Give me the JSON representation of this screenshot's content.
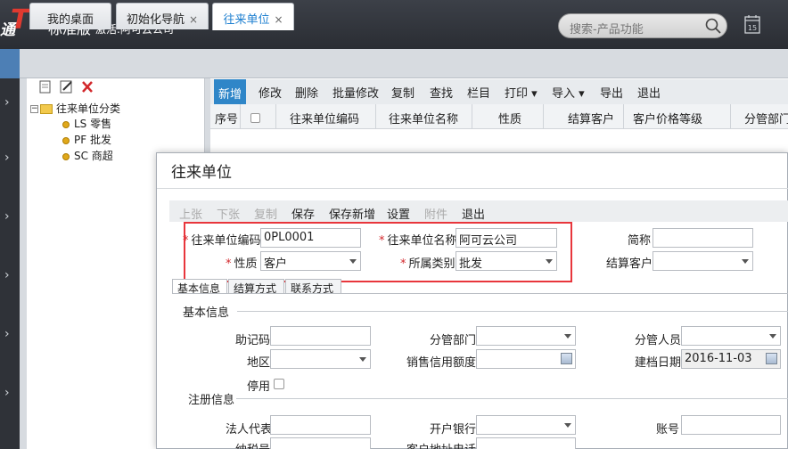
{
  "header": {
    "brand_edge": "通",
    "brand_logo": "T⁺",
    "edition": "标准版",
    "activate": "激活.阿可云公司",
    "search_placeholder": "搜索-产品功能",
    "calendar_day": "15"
  },
  "tabs": [
    {
      "label": "我的桌面"
    },
    {
      "label": "初始化导航",
      "close": "×"
    },
    {
      "label": "往来单位",
      "close": "×"
    }
  ],
  "tree": {
    "root": "往来单位分类",
    "items": [
      "LS 零售",
      "PF 批发",
      "SC 商超"
    ]
  },
  "list_toolbar": {
    "add": "新增",
    "edit": "修改",
    "delete": "删除",
    "batch_edit": "批量修改",
    "copy": "复制",
    "find": "查找",
    "columns": "栏目",
    "print": "打印",
    "import": "导入",
    "export": "导出",
    "exit": "退出"
  },
  "grid_headers": [
    "序号",
    "往来单位编码",
    "往来单位名称",
    "性质",
    "结算客户",
    "客户价格等级",
    "分管部门"
  ],
  "dialog": {
    "title": "往来单位",
    "toolbar": {
      "prev": "上张",
      "next": "下张",
      "copy": "复制",
      "save": "保存",
      "save_new": "保存新增",
      "settings": "设置",
      "attach": "附件",
      "exit": "退出"
    },
    "fields": {
      "code_label": "往来单位编码",
      "code_value": "0PL0001",
      "name_label": "往来单位名称",
      "name_value": "阿可云公司",
      "abbr_label": "简称",
      "abbr_value": "",
      "nature_label": "性质",
      "nature_value": "客户",
      "category_label": "所属类别",
      "category_value": "批发",
      "settle_label": "结算客户",
      "settle_value": ""
    },
    "form_tabs": [
      "基本信息",
      "结算方式",
      "联系方式"
    ],
    "basic": {
      "section": "基本信息",
      "mnemonic_label": "助记码",
      "dept_label": "分管部门",
      "person_label": "分管人员",
      "region_label": "地区",
      "credit_label": "销售信用额度",
      "created_label": "建档日期",
      "created_value": "2016-11-03",
      "disabled_label": "停用",
      "reg_section": "注册信息",
      "legal_label": "法人代表",
      "bank_label": "开户银行",
      "account_label": "账号",
      "tax_label": "纳税号",
      "phone_label": "客户地址电话"
    }
  },
  "colors": {
    "accent": "#2f86c8",
    "highlight": "#e8363c",
    "required": "#d2282c",
    "logo": "#e03a30"
  }
}
